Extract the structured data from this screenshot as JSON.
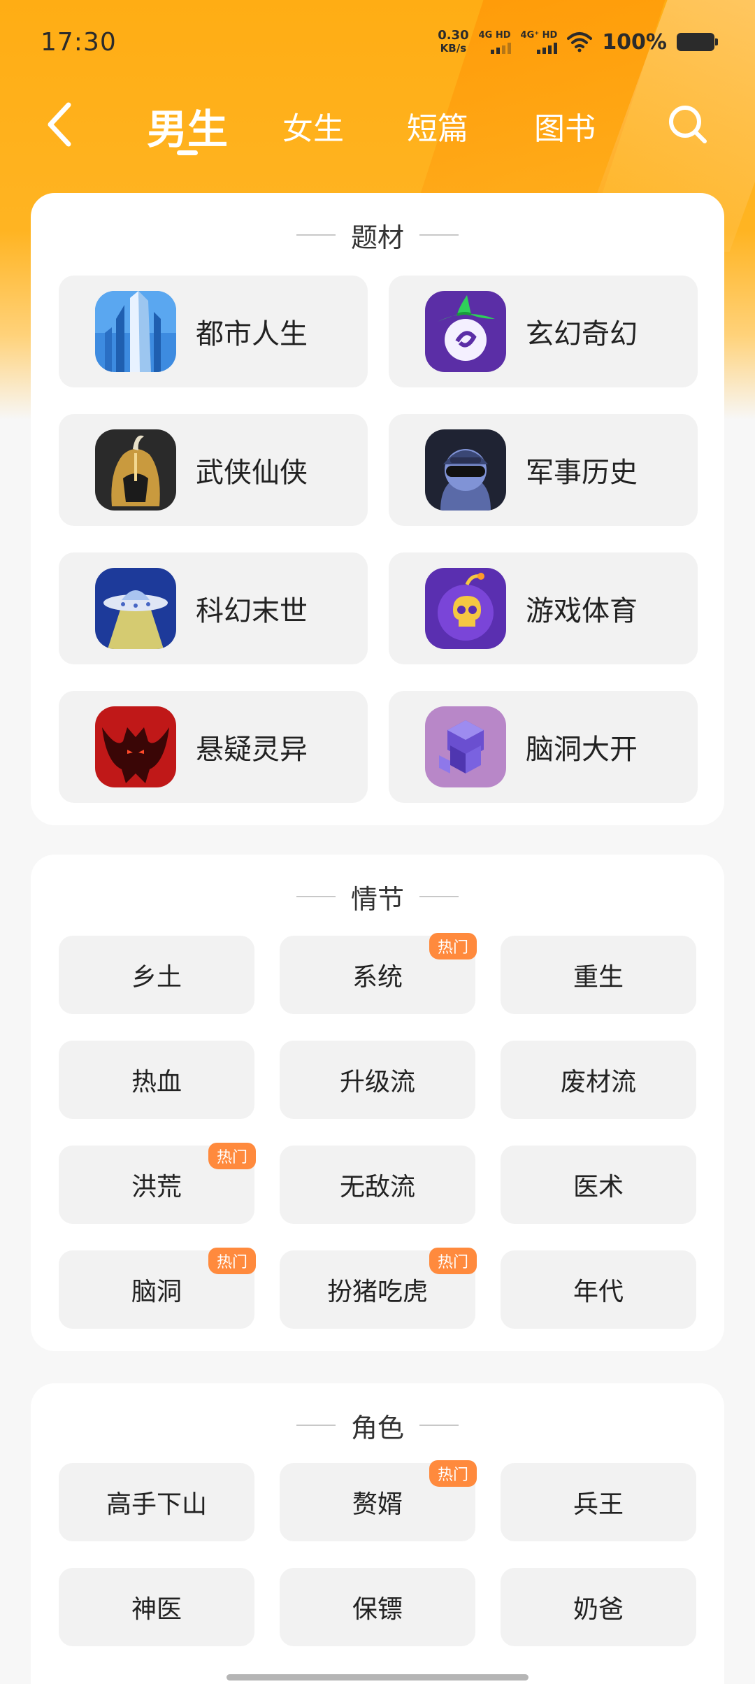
{
  "status": {
    "time": "17:30",
    "net_speed_value": "0.30",
    "net_speed_unit": "KB/s",
    "sim1": "4G HD",
    "sim2": "4G⁺ HD",
    "battery": "100%"
  },
  "nav": {
    "tabs": [
      {
        "label": "男生",
        "active": true
      },
      {
        "label": "女生",
        "active": false
      },
      {
        "label": "短篇",
        "active": false
      },
      {
        "label": "图书",
        "active": false
      }
    ]
  },
  "theme_section": {
    "title": "题材",
    "items": [
      {
        "label": "都市人生",
        "icon": "city-skyscraper-icon"
      },
      {
        "label": "玄幻奇幻",
        "icon": "witch-hat-orb-icon"
      },
      {
        "label": "武侠仙侠",
        "icon": "warrior-helmet-icon"
      },
      {
        "label": "军事历史",
        "icon": "soldier-helmet-icon"
      },
      {
        "label": "科幻末世",
        "icon": "ufo-icon"
      },
      {
        "label": "游戏体育",
        "icon": "skull-bomb-icon"
      },
      {
        "label": "悬疑灵异",
        "icon": "demon-icon"
      },
      {
        "label": "脑洞大开",
        "icon": "cubes-icon"
      }
    ]
  },
  "plot_section": {
    "title": "情节",
    "items": [
      {
        "label": "乡土",
        "badge": ""
      },
      {
        "label": "系统",
        "badge": "热门"
      },
      {
        "label": "重生",
        "badge": ""
      },
      {
        "label": "热血",
        "badge": ""
      },
      {
        "label": "升级流",
        "badge": ""
      },
      {
        "label": "废材流",
        "badge": ""
      },
      {
        "label": "洪荒",
        "badge": "热门"
      },
      {
        "label": "无敌流",
        "badge": ""
      },
      {
        "label": "医术",
        "badge": ""
      },
      {
        "label": "脑洞",
        "badge": "热门"
      },
      {
        "label": "扮猪吃虎",
        "badge": "热门"
      },
      {
        "label": "年代",
        "badge": ""
      }
    ]
  },
  "role_section": {
    "title": "角色",
    "items": [
      {
        "label": "高手下山",
        "badge": ""
      },
      {
        "label": "赘婿",
        "badge": "热门"
      },
      {
        "label": "兵王",
        "badge": ""
      },
      {
        "label": "神医",
        "badge": ""
      },
      {
        "label": "保镖",
        "badge": ""
      },
      {
        "label": "奶爸",
        "badge": ""
      }
    ]
  },
  "colors": {
    "header_orange": "#ffad14",
    "hot_badge": "#ff8a3d",
    "tile_bg": "#f2f2f2"
  }
}
